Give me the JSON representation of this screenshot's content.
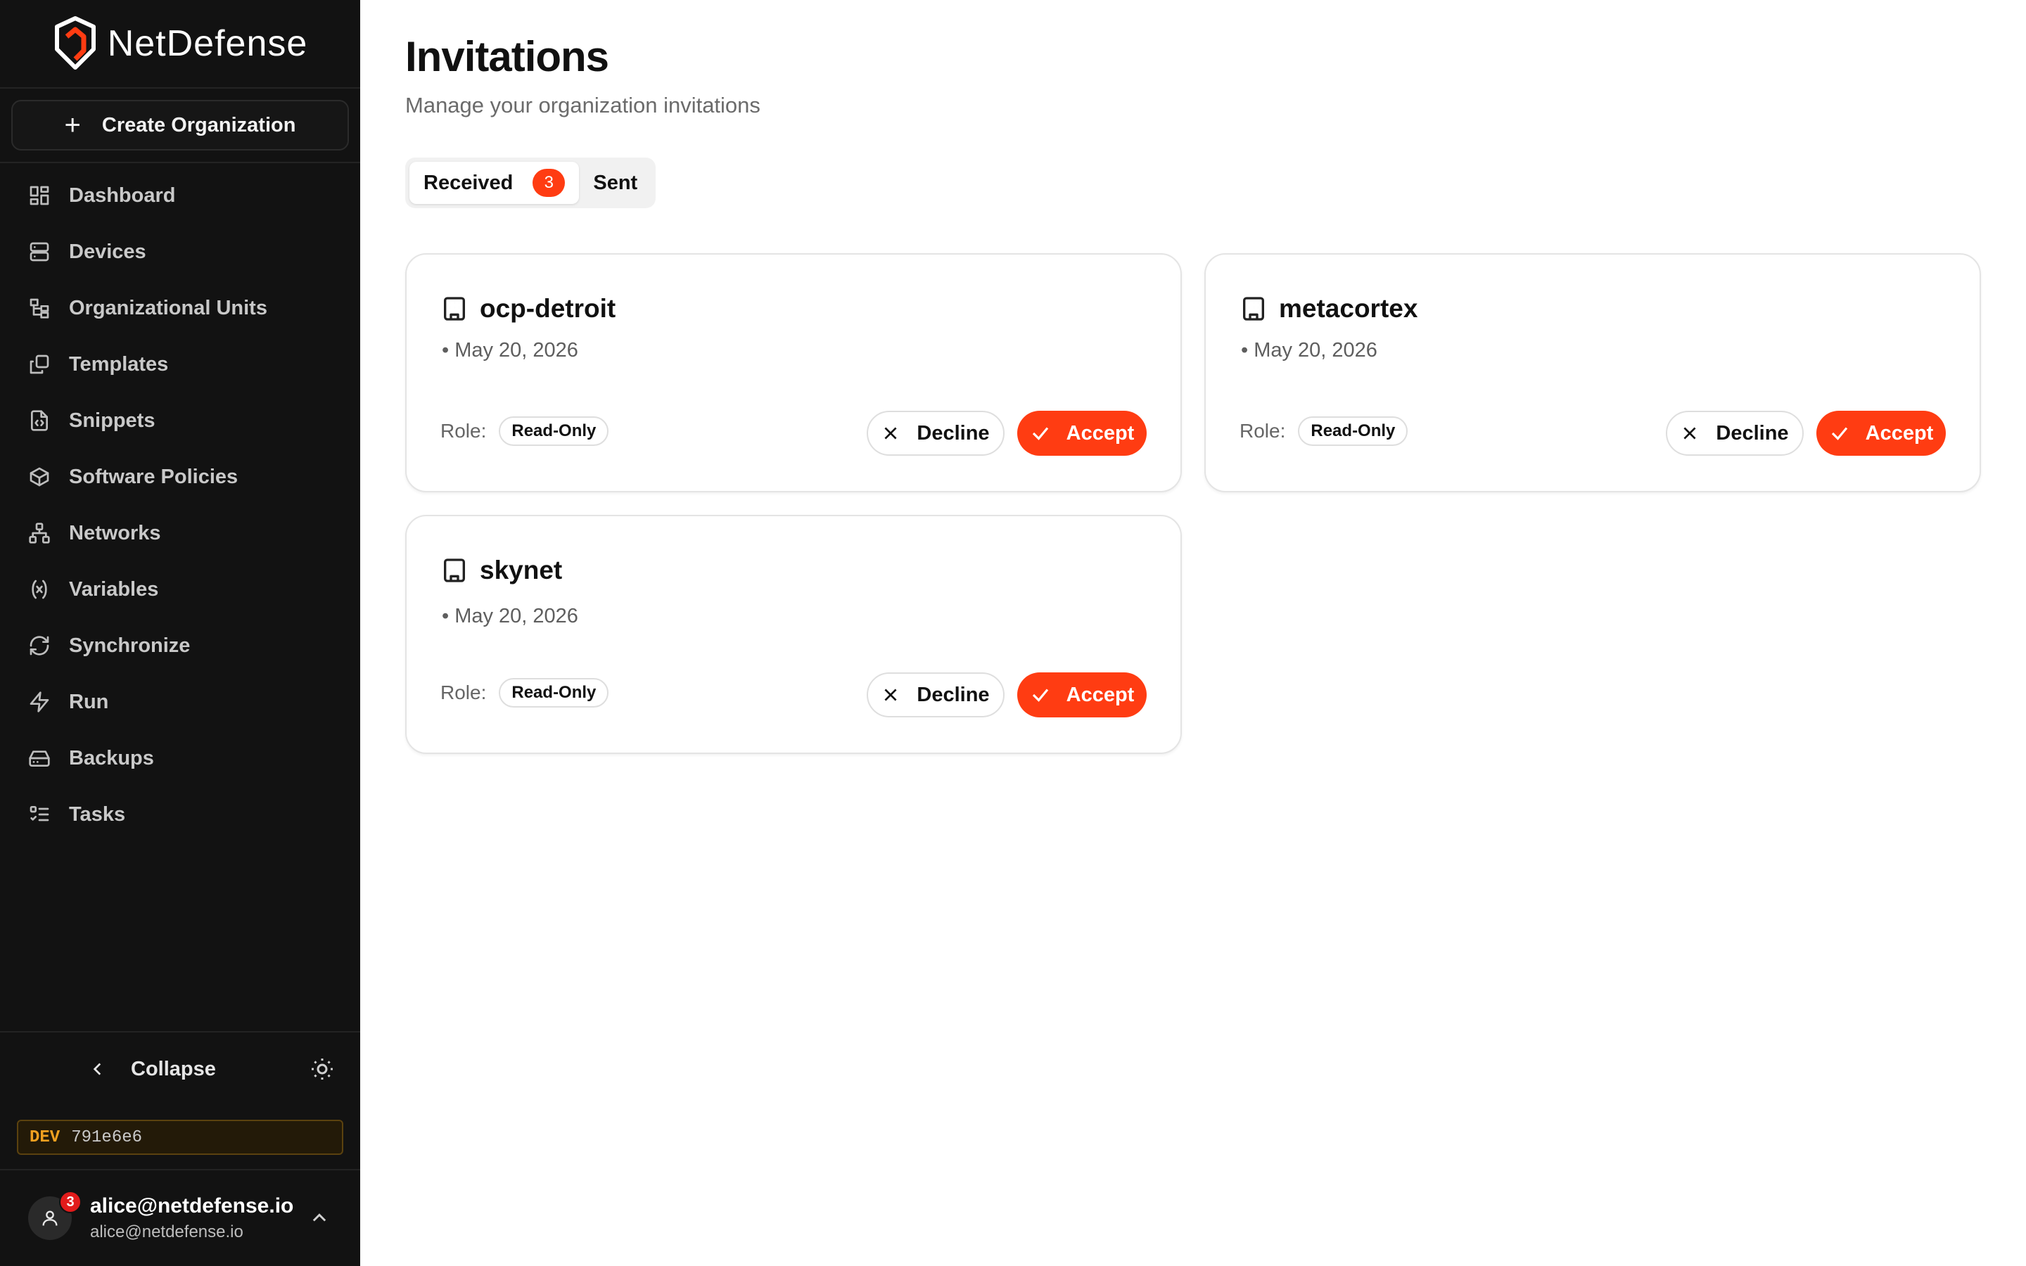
{
  "brand": {
    "name": "NetDefense",
    "accent": "#ff3c12"
  },
  "sidebar": {
    "create_label": "Create Organization",
    "items": [
      {
        "label": "Dashboard",
        "icon": "dashboard-icon"
      },
      {
        "label": "Devices",
        "icon": "server-icon"
      },
      {
        "label": "Organizational Units",
        "icon": "org-tree-icon"
      },
      {
        "label": "Templates",
        "icon": "templates-icon"
      },
      {
        "label": "Snippets",
        "icon": "code-file-icon"
      },
      {
        "label": "Software Policies",
        "icon": "package-icon"
      },
      {
        "label": "Networks",
        "icon": "network-icon"
      },
      {
        "label": "Variables",
        "icon": "variable-icon"
      },
      {
        "label": "Synchronize",
        "icon": "refresh-icon"
      },
      {
        "label": "Run",
        "icon": "lightning-icon"
      },
      {
        "label": "Backups",
        "icon": "hard-drive-icon"
      },
      {
        "label": "Tasks",
        "icon": "list-checks-icon"
      }
    ],
    "collapse_label": "Collapse",
    "env": {
      "tag": "DEV",
      "hash": "791e6e6"
    },
    "user": {
      "name": "alice@netdefense.io",
      "email": "alice@netdefense.io",
      "notifications": "3"
    }
  },
  "main": {
    "title": "Invitations",
    "subtitle": "Manage your organization invitations",
    "tabs": [
      {
        "label": "Received",
        "count": "3"
      },
      {
        "label": "Sent"
      }
    ],
    "role_label": "Role:",
    "decline_label": "Decline",
    "accept_label": "Accept",
    "invitations": [
      {
        "org": "ocp-detroit",
        "date": "• May 20, 2026",
        "role": "Read-Only"
      },
      {
        "org": "metacortex",
        "date": "• May 20, 2026",
        "role": "Read-Only"
      },
      {
        "org": "skynet",
        "date": "• May 20, 2026",
        "role": "Read-Only"
      }
    ]
  }
}
